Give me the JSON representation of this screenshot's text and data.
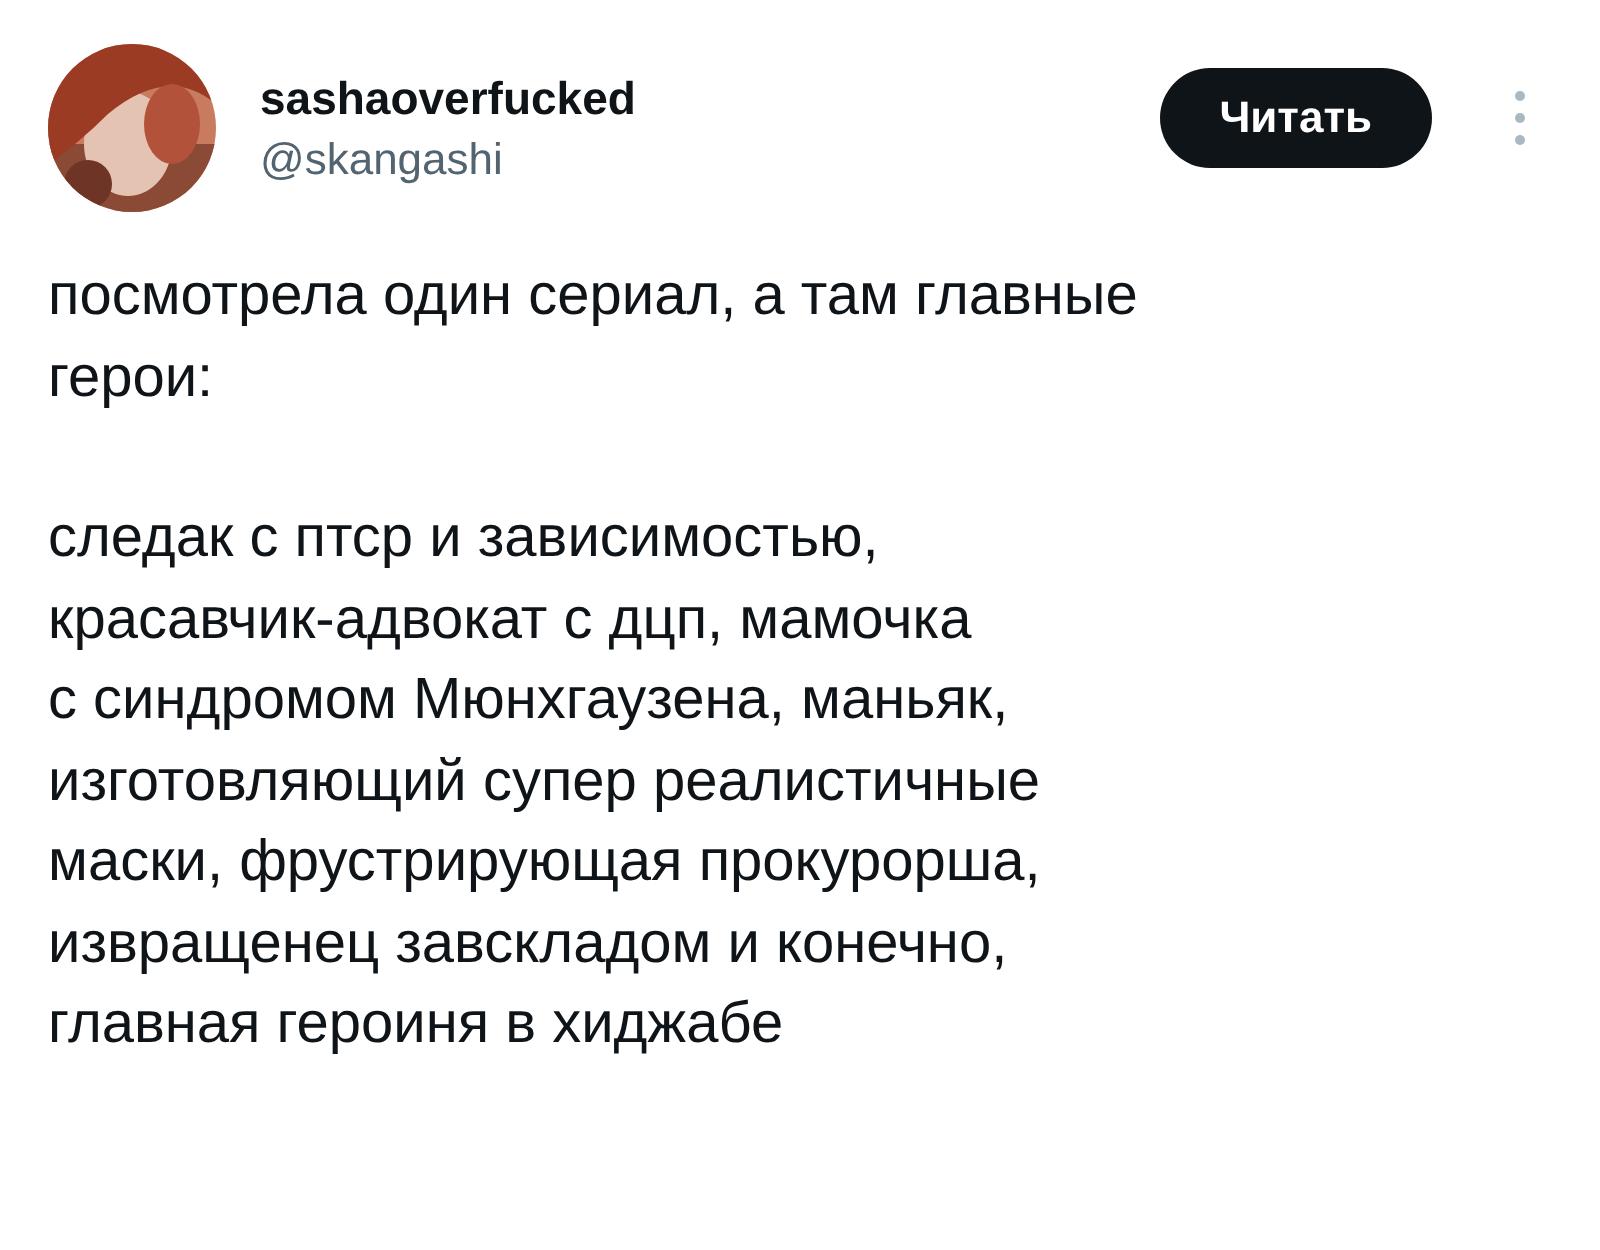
{
  "author": {
    "name": "sashaoverfucked",
    "handle": "@skangashi"
  },
  "follow_button": {
    "label": "Читать"
  },
  "paragraphs": [
    {
      "lines": [
        "посмотрела один сериал, а там главные",
        "герои:"
      ]
    },
    {
      "lines": [
        "следак с птср и зависимостью,",
        "красавчик-адвокат с дцп, мамочка",
        "с синдромом Мюнхгаузена, маньяк,",
        "изготовляющий супер реалистичные",
        "маски, фрустрирующая прокурорша,",
        "извращенец завскладом и конечно,",
        "главная героиня в хиджабе"
      ]
    }
  ]
}
